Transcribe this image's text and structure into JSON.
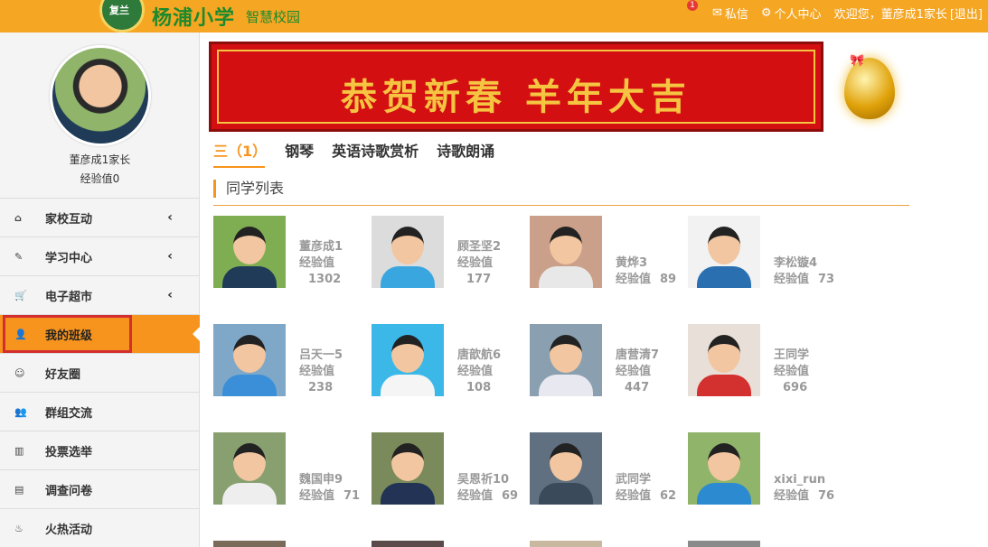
{
  "header": {
    "logo_badge": "复兰",
    "school_name": "杨浦小学",
    "school_suffix": "智慧校园",
    "messages_label": "私信",
    "messages_count": "1",
    "profile_label": "个人中心",
    "welcome": "欢迎您，董彦成1家长",
    "logout": "[退出]"
  },
  "user": {
    "name": "董彦成1家长",
    "exp": "经验值0"
  },
  "menu": [
    {
      "label": "家校互动",
      "icon": "home-icon",
      "glyph": "⌂",
      "chevron": "‹"
    },
    {
      "label": "学习中心",
      "icon": "edit-icon",
      "glyph": "✎",
      "chevron": "‹"
    },
    {
      "label": "电子超市",
      "icon": "cart-icon",
      "glyph": "🛒",
      "chevron": "‹"
    },
    {
      "label": "我的班级",
      "icon": "user-icon",
      "glyph": "👤",
      "chevron": ""
    },
    {
      "label": "好友圈",
      "icon": "smile-icon",
      "glyph": "☺",
      "chevron": ""
    },
    {
      "label": "群组交流",
      "icon": "group-icon",
      "glyph": "👥",
      "chevron": ""
    },
    {
      "label": "投票选举",
      "icon": "bar-chart-icon",
      "glyph": "▥",
      "chevron": ""
    },
    {
      "label": "调查问卷",
      "icon": "document-icon",
      "glyph": "▤",
      "chevron": ""
    },
    {
      "label": "火热活动",
      "icon": "flame-icon",
      "glyph": "♨",
      "chevron": ""
    }
  ],
  "banner": {
    "text": "恭贺新春 羊年大吉"
  },
  "tabs": [
    {
      "label": "三（1）",
      "active": true
    },
    {
      "label": "钢琴",
      "active": false
    },
    {
      "label": "英语诗歌赏析",
      "active": false
    },
    {
      "label": "诗歌朗诵",
      "active": false
    }
  ],
  "section_title": "同学列表",
  "exp_label": "经验值",
  "students": [
    {
      "name": "董彦成1",
      "exp": "1302"
    },
    {
      "name": "顾圣坚2",
      "exp": "177"
    },
    {
      "name": "黄烨3",
      "exp": "89"
    },
    {
      "name": "李松镟4",
      "exp": "73"
    },
    {
      "name": "吕天一5",
      "exp": "238"
    },
    {
      "name": "唐歆航6",
      "exp": "108"
    },
    {
      "name": "唐营清7",
      "exp": "447"
    },
    {
      "name": "王同学",
      "exp": "696"
    },
    {
      "name": "魏国申9",
      "exp": "71"
    },
    {
      "name": "吴恩祈10",
      "exp": "69"
    },
    {
      "name": "武同学",
      "exp": "62"
    },
    {
      "name": "xixi_run",
      "exp": "76"
    }
  ],
  "colors": {
    "accent": "#f7941d",
    "topbar": "#f5a623",
    "active_outline": "#d32f2f",
    "banner_red": "#d40f12",
    "banner_gold": "#f5c542"
  }
}
